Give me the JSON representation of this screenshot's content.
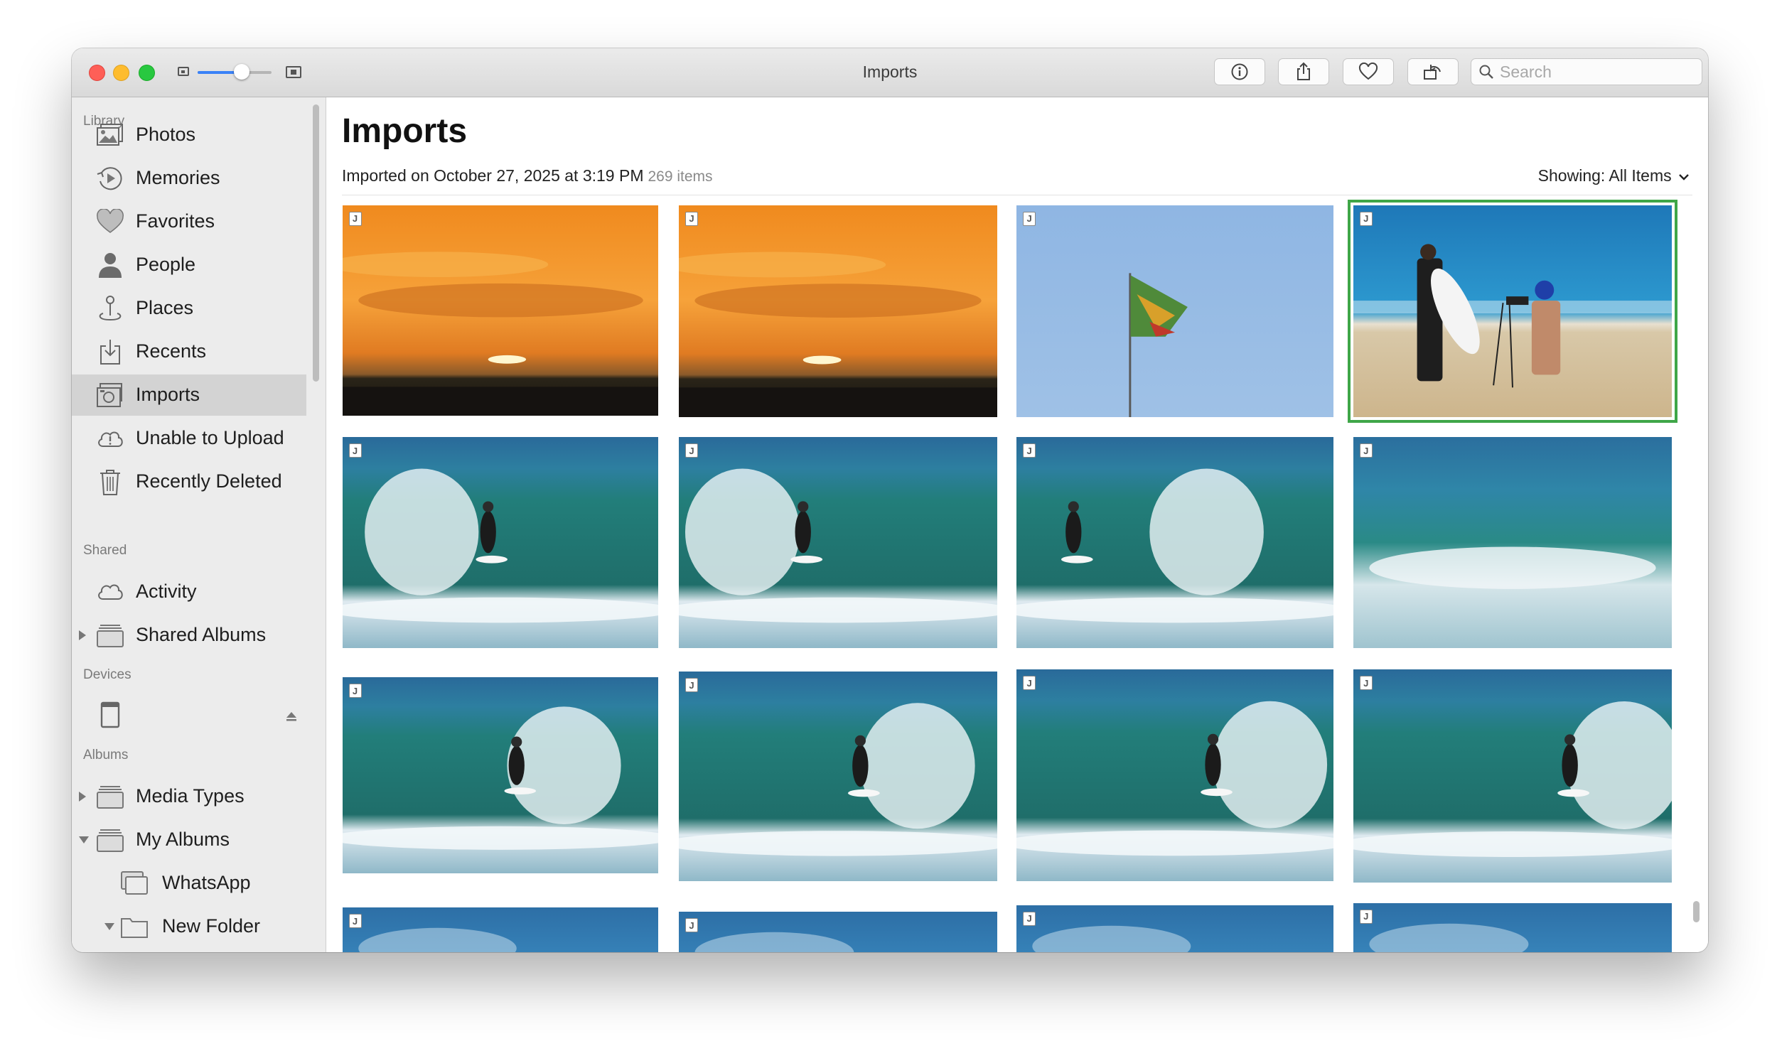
{
  "window": {
    "title": "Imports"
  },
  "toolbar": {
    "search_placeholder": "Search",
    "zoom_level": 0.6
  },
  "sidebar": {
    "sections": {
      "library": "Library",
      "shared": "Shared",
      "devices": "Devices",
      "albums": "Albums"
    },
    "library_items": [
      {
        "label": "Photos",
        "icon": "photos-icon"
      },
      {
        "label": "Memories",
        "icon": "memories-icon"
      },
      {
        "label": "Favorites",
        "icon": "heart-icon"
      },
      {
        "label": "People",
        "icon": "person-icon"
      },
      {
        "label": "Places",
        "icon": "pin-icon"
      },
      {
        "label": "Recents",
        "icon": "recents-icon"
      },
      {
        "label": "Imports",
        "icon": "camera-icon",
        "selected": true
      },
      {
        "label": "Unable to Upload",
        "icon": "cloud-alert-icon"
      },
      {
        "label": "Recently Deleted",
        "icon": "trash-icon"
      }
    ],
    "shared_items": [
      {
        "label": "Activity",
        "icon": "cloud-icon"
      },
      {
        "label": "Shared Albums",
        "icon": "folder-icon"
      }
    ],
    "album_items": [
      {
        "label": "Media Types",
        "icon": "folder-icon"
      },
      {
        "label": "My Albums",
        "icon": "folder-icon"
      },
      {
        "label": "WhatsApp",
        "icon": "album-icon"
      },
      {
        "label": "New Folder",
        "icon": "folder-icon"
      }
    ]
  },
  "main": {
    "title": "Imports",
    "subtitle_prefix": "Imported on ",
    "subtitle_date": "October 27, 2025 at 3:19 PM",
    "item_count": "269 items",
    "showing_label": "Showing: ",
    "showing_value": "All Items",
    "badge": "J"
  },
  "colors": {
    "accent": "#3a82f7",
    "selection_border": "#3fa648",
    "close": "#fe5f57",
    "minimize": "#febc2e",
    "maximize": "#28c840"
  }
}
